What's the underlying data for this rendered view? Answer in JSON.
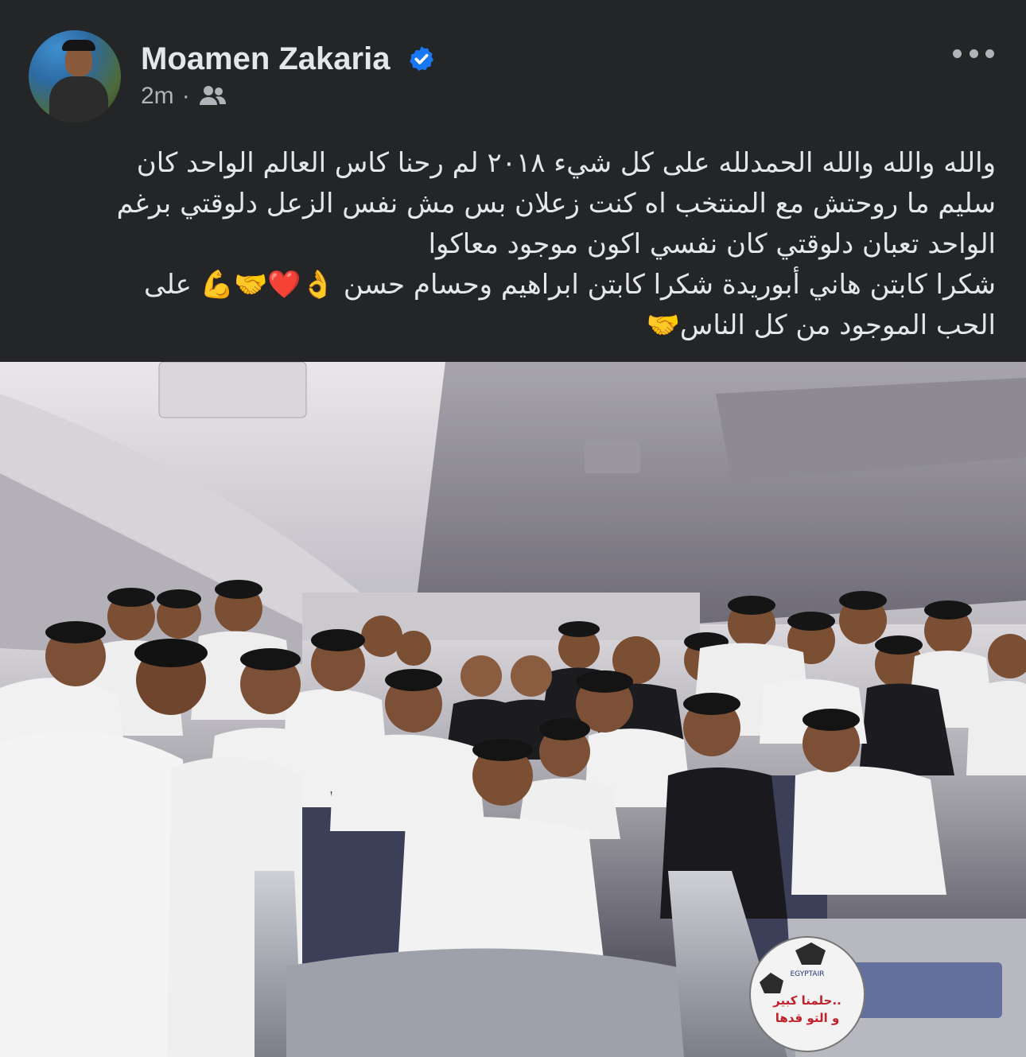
{
  "post": {
    "author_name": "Moamen Zakaria",
    "time": "2m",
    "separator": "·",
    "text_lines": [
      "والله والله والله الحمدلله على كل شيء ٢٠١٨ لم رحنا كاس العالم الواحد كان",
      "سليم ما روحتش مع المنتخب اه كنت زعلان بس مش نفس الزعل دلوقتي برغم",
      "الواحد تعبان دلوقتي كان نفسي اكون موجود معاكوا",
      "شكرا كابتن هاني أبوريدة شكرا كابتن ابراهيم وحسام حسن 👌❤️🤝💪 على",
      "الحب الموجود من كل الناس🤝"
    ]
  },
  "photo": {
    "ball_line1": "حلمنا كبير..",
    "ball_line2": "و التو قدها",
    "ball_brand": "EGYPTAIR"
  },
  "colors": {
    "background": "#242526",
    "text_primary": "#e4e6eb",
    "text_secondary": "#b0b3b8",
    "verified_blue": "#1877f2"
  },
  "icons": {
    "verified": "verified-badge-icon",
    "audience": "friends-audience-icon",
    "more": "more-options-icon"
  }
}
